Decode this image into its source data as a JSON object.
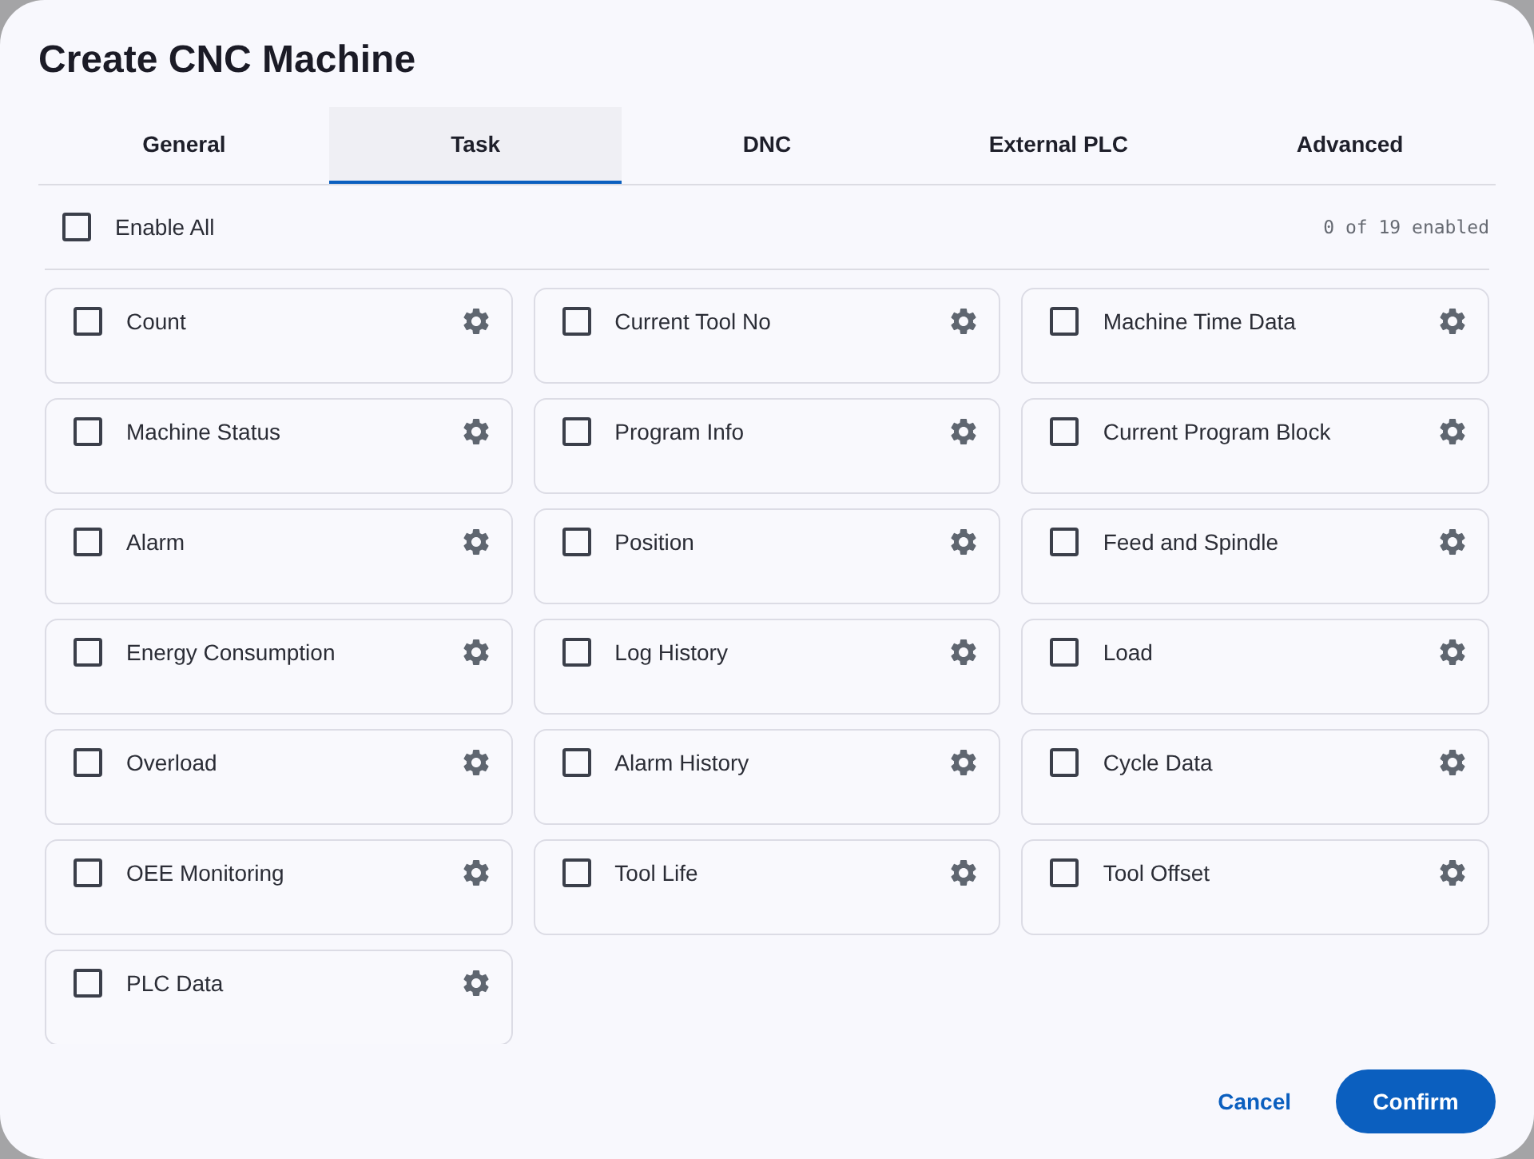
{
  "dialog": {
    "title": "Create CNC Machine"
  },
  "tabs": [
    {
      "label": "General",
      "selected": false
    },
    {
      "label": "Task",
      "selected": true
    },
    {
      "label": "DNC",
      "selected": false
    },
    {
      "label": "External PLC",
      "selected": false
    },
    {
      "label": "Advanced",
      "selected": false
    }
  ],
  "enable_all": {
    "label": "Enable All",
    "checked": false,
    "count": "0 of 19 enabled"
  },
  "tasks": [
    {
      "label": "Count",
      "checked": false
    },
    {
      "label": "Current Tool No",
      "checked": false
    },
    {
      "label": "Machine Time Data",
      "checked": false
    },
    {
      "label": "Machine Status",
      "checked": false
    },
    {
      "label": "Program Info",
      "checked": false
    },
    {
      "label": "Current Program Block",
      "checked": false
    },
    {
      "label": "Alarm",
      "checked": false
    },
    {
      "label": "Position",
      "checked": false
    },
    {
      "label": "Feed and Spindle",
      "checked": false
    },
    {
      "label": "Energy Consumption",
      "checked": false
    },
    {
      "label": "Log History",
      "checked": false
    },
    {
      "label": "Load",
      "checked": false
    },
    {
      "label": "Overload",
      "checked": false
    },
    {
      "label": "Alarm History",
      "checked": false
    },
    {
      "label": "Cycle Data",
      "checked": false
    },
    {
      "label": "OEE Monitoring",
      "checked": false
    },
    {
      "label": "Tool Life",
      "checked": false
    },
    {
      "label": "Tool Offset",
      "checked": false
    },
    {
      "label": "PLC Data",
      "checked": false
    }
  ],
  "buttons": [
    {
      "label": "Cancel",
      "kind": "text"
    },
    {
      "label": "Confirm",
      "kind": "primary"
    }
  ]
}
